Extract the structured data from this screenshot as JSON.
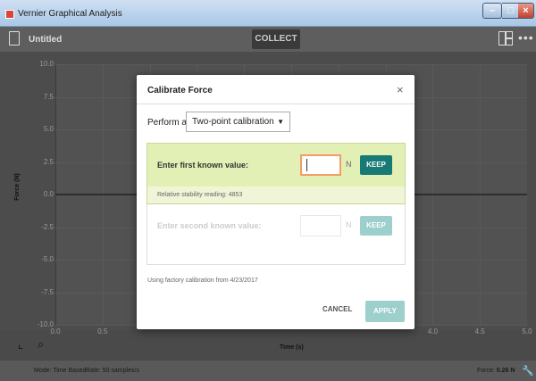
{
  "window": {
    "title": "Vernier Graphical Analysis"
  },
  "toolbar": {
    "document_title": "Untitled",
    "collect_label": "COLLECT",
    "more_label": "•••"
  },
  "graph": {
    "y_label": "Force (N)",
    "x_label": "Time (s)",
    "y_ticks": [
      "10.0",
      "7.5",
      "5.0",
      "2.5",
      "0.0",
      "-2.5",
      "-5.0",
      "-7.5",
      "-10.0"
    ],
    "x_ticks": [
      "0.0",
      "0.5",
      "4.0",
      "4.5",
      "5.0"
    ]
  },
  "status": {
    "mode": "Mode: Time Based",
    "rate": "Rate: 50 samples/s",
    "force_label": "Force:",
    "force_value": "0.26 N"
  },
  "dialog": {
    "title": "Calibrate Force",
    "close_glyph": "×",
    "perform_label": "Perform a",
    "method": "Two-point calibration",
    "step1": {
      "label": "Enter first known value:",
      "value": "",
      "unit": "N",
      "keep_label": "KEEP",
      "stability": "Relative stability reading: 4853"
    },
    "step2": {
      "label": "Enter second known value:",
      "value": "",
      "unit": "N",
      "keep_label": "KEEP"
    },
    "factory_note": "Using factory calibration from 4/23/2017",
    "cancel_label": "CANCEL",
    "apply_label": "APPLY"
  },
  "colors": {
    "keep_active": "#177a74",
    "keep_disabled": "#9dcfcd",
    "step_active_bg": "#e2f0b5",
    "input_focus": "#f29d62"
  },
  "icons": [
    "app-icon",
    "document-icon",
    "layout-icon",
    "more-icon",
    "graph-options-icon",
    "zoom-icon",
    "wrench-icon",
    "close-icon",
    "dropdown-caret-icon"
  ]
}
